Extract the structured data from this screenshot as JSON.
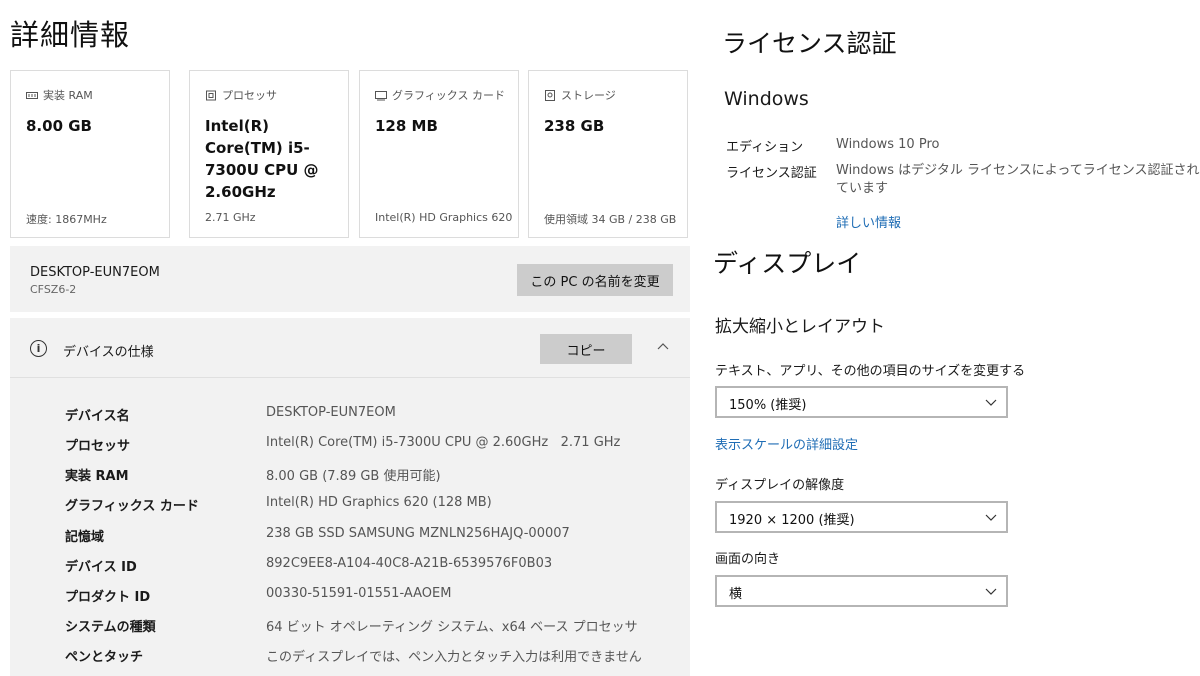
{
  "page_title": "詳細情報",
  "cards": [
    {
      "icon": "ram-icon",
      "label": "実装 RAM",
      "value": "8.00 GB",
      "foot": "速度: 1867MHz"
    },
    {
      "icon": "processor-icon",
      "label": "プロセッサ",
      "value": "Intel(R) Core(TM) i5-7300U CPU @ 2.60GHz",
      "foot": "2.71 GHz"
    },
    {
      "icon": "graphics-card-icon",
      "label": "グラフィックス カード",
      "value": "128 MB",
      "foot": "Intel(R) HD Graphics 620"
    },
    {
      "icon": "storage-icon",
      "label": "ストレージ",
      "value": "238 GB",
      "foot": "使用領域 34 GB / 238 GB"
    }
  ],
  "device": {
    "name": "DESKTOP-EUN7EOM",
    "model": "CFSZ6-2",
    "rename_button": "この PC の名前を変更"
  },
  "spec": {
    "title": "デバイスの仕様",
    "copy_button": "コピー",
    "rows": [
      {
        "key": "デバイス名",
        "value": "DESKTOP-EUN7EOM"
      },
      {
        "key": "プロセッサ",
        "value": "Intel(R) Core(TM) i5-7300U CPU @ 2.60GHz   2.71 GHz"
      },
      {
        "key": "実装 RAM",
        "value": "8.00 GB (7.89 GB 使用可能)"
      },
      {
        "key": "グラフィックス カード",
        "value": "Intel(R) HD Graphics 620 (128 MB)"
      },
      {
        "key": "記憶域",
        "value": "238 GB SSD SAMSUNG MZNLN256HAJQ-00007"
      },
      {
        "key": "デバイス ID",
        "value": "892C9EE8-A104-40C8-A21B-6539576F0B03"
      },
      {
        "key": "プロダクト ID",
        "value": "00330-51591-01551-AAOEM"
      },
      {
        "key": "システムの種類",
        "value": "64 ビット オペレーティング システム、x64 ベース プロセッサ"
      },
      {
        "key": "ペンとタッチ",
        "value": "このディスプレイでは、ペン入力とタッチ入力は利用できません"
      }
    ]
  },
  "license": {
    "title": "ライセンス認証",
    "heading": "Windows",
    "edition_label": "エディション",
    "edition_value": "Windows 10 Pro",
    "activation_label": "ライセンス認証",
    "activation_value": "Windows はデジタル ライセンスによってライセンス認証されています",
    "more_info_link": "詳しい情報"
  },
  "display": {
    "title": "ディスプレイ",
    "scale_heading": "拡大縮小とレイアウト",
    "size_label": "テキスト、アプリ、その他の項目のサイズを変更する",
    "size_value": "150% (推奨)",
    "advanced_scale_link": "表示スケールの詳細設定",
    "resolution_label": "ディスプレイの解像度",
    "resolution_value": "1920 × 1200 (推奨)",
    "orientation_label": "画面の向き",
    "orientation_value": "横"
  }
}
